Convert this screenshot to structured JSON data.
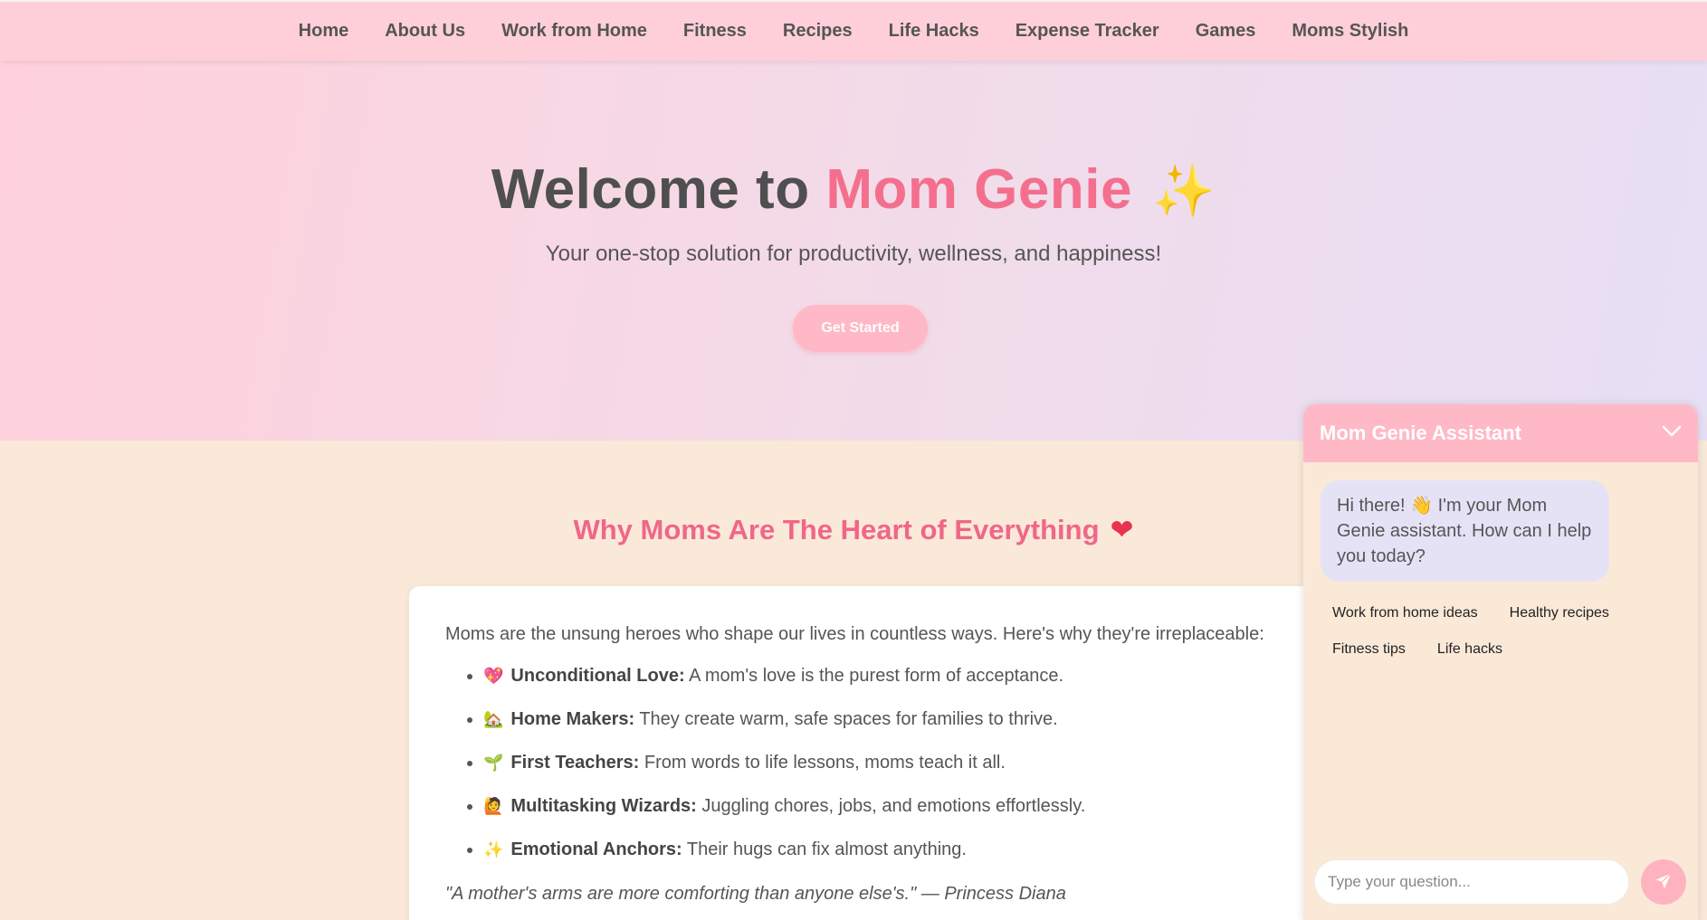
{
  "nav": {
    "items": [
      "Home",
      "About Us",
      "Work from Home",
      "Fitness",
      "Recipes",
      "Life Hacks",
      "Expense Tracker",
      "Games",
      "Moms Stylish"
    ]
  },
  "hero": {
    "title_prefix": "Welcome to ",
    "title_brand": "Mom Genie",
    "title_emoji": "✨",
    "subtitle": "Your one-stop solution for productivity, wellness, and happiness!",
    "cta_label": "Get Started"
  },
  "section": {
    "title": "Why Moms Are The Heart of Everything",
    "title_emoji": "❤",
    "intro": "Moms are the unsung heroes who shape our lives in countless ways. Here's why they're irreplaceable:",
    "items": [
      {
        "emoji": "💖",
        "label": "Unconditional Love:",
        "text": " A mom's love is the purest form of acceptance."
      },
      {
        "emoji": "🏡",
        "label": "Home Makers:",
        "text": " They create warm, safe spaces for families to thrive."
      },
      {
        "emoji": "🌱",
        "label": "First Teachers:",
        "text": " From words to life lessons, moms teach it all."
      },
      {
        "emoji": "🙋",
        "label": "Multitasking Wizards:",
        "text": " Juggling chores, jobs, and emotions effortlessly."
      },
      {
        "emoji": "✨",
        "label": "Emotional Anchors:",
        "text": " Their hugs can fix almost anything."
      }
    ],
    "quote": "\"A mother's arms are more comforting than anyone else's.\" — Princess Diana"
  },
  "chat": {
    "title": "Mom Genie Assistant",
    "greeting": "Hi there! 👋 I'm your Mom Genie assistant. How can I help you today?",
    "suggestions": [
      "Work from home ideas",
      "Healthy recipes",
      "Fitness tips",
      "Life hacks"
    ],
    "input_placeholder": "Type your question..."
  },
  "colors": {
    "nav_bg": "#ffcfd9",
    "brand_pink": "#f46f8e",
    "section_title": "#f06689",
    "page_bg": "#fae9d8",
    "chat_header": "#ffb8c6",
    "bubble_bg": "#e6e2f6"
  },
  "icons": {
    "chat_toggle": "chevron-down-icon",
    "send": "paper-plane-icon"
  }
}
